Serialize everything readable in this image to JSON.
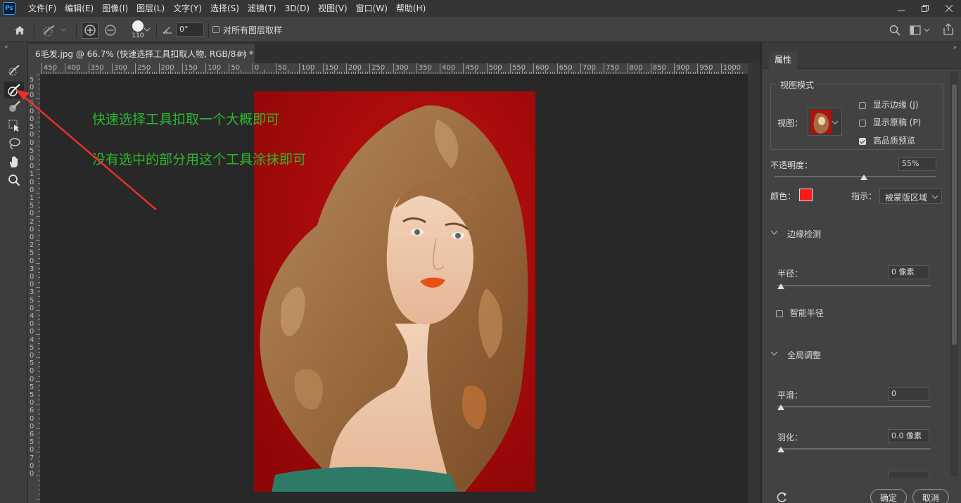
{
  "app": {
    "logo": "Ps"
  },
  "menu": [
    "文件(F)",
    "编辑(E)",
    "图像(I)",
    "图层(L)",
    "文字(Y)",
    "选择(S)",
    "滤镜(T)",
    "3D(D)",
    "视图(V)",
    "窗口(W)",
    "帮助(H)"
  ],
  "options_bar": {
    "brush_size": "110",
    "angle_value": "0°",
    "sample_all_layers_label": "对所有图层取样",
    "sample_all_layers_checked": false
  },
  "document": {
    "tab_title": "6毛发.jpg @ 66.7% (快速选择工具扣取人物, RGB/8#) *",
    "close_glyph": "×"
  },
  "ruler": {
    "top_labels": [
      "450",
      "400",
      "350",
      "300",
      "250",
      "200",
      "150",
      "100",
      "50",
      "0",
      "50",
      "100",
      "150",
      "200",
      "250",
      "300",
      "350",
      "400",
      "450",
      "500",
      "550",
      "600",
      "650",
      "700",
      "750",
      "800",
      "850",
      "900",
      "950",
      "1000"
    ],
    "left_labels": [
      "5",
      "0",
      "0",
      "5",
      "0",
      "0",
      "5",
      "0",
      "0",
      "5",
      "0",
      "0",
      "1",
      "0",
      "0",
      "1",
      "5",
      "0",
      "2",
      "0",
      "0",
      "2",
      "5",
      "0",
      "3",
      "0",
      "0",
      "3",
      "5",
      "0",
      "4",
      "0",
      "0",
      "4",
      "5",
      "0",
      "5",
      "0",
      "0",
      "5",
      "5",
      "0",
      "6",
      "0",
      "0",
      "6",
      "5",
      "0",
      "7",
      "0",
      "0"
    ]
  },
  "annotations": {
    "line1": "快速选择工具扣取一个大概即可",
    "line2": "没有选中的部分用这个工具涂抹即可",
    "color": "#2db82d",
    "arrow_color": "#e8312a"
  },
  "canvas_image": {
    "background_color": "#a80a0a",
    "description_icon": "portrait-photo"
  },
  "panel": {
    "tab": "属性",
    "view_mode_title": "视图模式",
    "view_label": "视图：",
    "show_edge_label": "显示边缘 (J)",
    "show_edge_checked": false,
    "show_original_label": "显示原稿 (P)",
    "show_original_checked": false,
    "hq_preview_label": "高品质预览",
    "hq_preview_checked": true,
    "opacity_label": "不透明度：",
    "opacity_value": "55%",
    "opacity_fraction": 0.55,
    "color_label": "颜色：",
    "color_value": "#ff1a1a",
    "indicate_label": "指示：",
    "indicate_value": "被蒙版区域",
    "edge_detection_title": "边缘检测",
    "radius_label": "半径：",
    "radius_value": "0 像素",
    "smart_radius_label": "智能半径",
    "smart_radius_checked": false,
    "global_refine_title": "全局调整",
    "smooth_label": "平滑：",
    "smooth_value": "0",
    "feather_label": "羽化：",
    "feather_value": "0.0 像素",
    "ok_label": "确定",
    "cancel_label": "取消"
  }
}
